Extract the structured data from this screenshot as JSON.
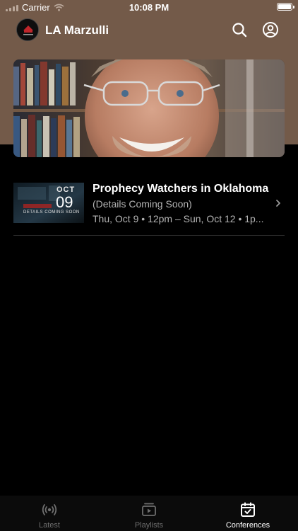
{
  "status_bar": {
    "carrier": "Carrier",
    "time": "10:08 PM",
    "icons": [
      "signal-icon",
      "wifi-icon",
      "battery-icon"
    ]
  },
  "header": {
    "title": "LA Marzulli",
    "icons": [
      "search-icon",
      "profile-icon"
    ]
  },
  "hero": {
    "image": "host-portrait"
  },
  "conferences": [
    {
      "thumbnail": {
        "month": "OCT",
        "day": "09",
        "caption": "DETAILS COMING SOON"
      },
      "title": "Prophecy Watchers in Oklahoma",
      "subtitle": "(Details Coming Soon)",
      "schedule": "Thu, Oct 9 • 12pm – Sun, Oct 12 • 1p..."
    }
  ],
  "tabbar": {
    "tabs": [
      {
        "label": "Latest",
        "icon": "broadcast-icon",
        "active": false
      },
      {
        "label": "Playlists",
        "icon": "playlist-icon",
        "active": false
      },
      {
        "label": "Conferences",
        "icon": "calendar-icon",
        "active": true
      }
    ]
  },
  "colors": {
    "header_bg": "#735a49",
    "background": "#000000",
    "secondary_text": "#b3b3b3",
    "inactive_tab": "#6e6e6e"
  }
}
